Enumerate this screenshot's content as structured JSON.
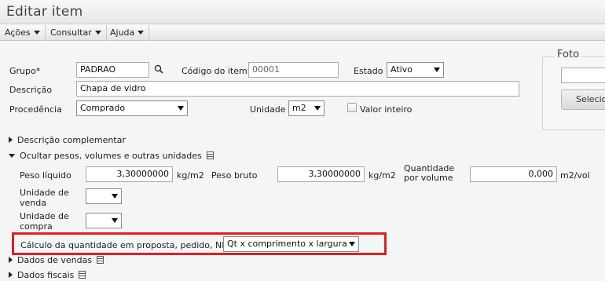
{
  "window": {
    "title": "Editar item"
  },
  "menus": [
    {
      "label": "Ações"
    },
    {
      "label": "Consultar"
    },
    {
      "label": "Ajuda"
    }
  ],
  "form": {
    "grupo": {
      "label": "Grupo*",
      "value": "PADRAO"
    },
    "codigo": {
      "label": "Código do item",
      "value": "00001"
    },
    "estado": {
      "label": "Estado",
      "value": "Ativo"
    },
    "descricao": {
      "label": "Descrição",
      "value": "Chapa de vidro"
    },
    "procedencia": {
      "label": "Procedência",
      "value": "Comprado"
    },
    "unidade": {
      "label": "Unidade",
      "value": "m2"
    },
    "valor_inteiro": {
      "label": "Valor inteiro",
      "checked": false
    }
  },
  "foto": {
    "legend": "Foto",
    "button_label": "Selecio"
  },
  "sections": {
    "descricao_complementar": "Descrição complementar",
    "ocultar_pesos": "Ocultar pesos, volumes e outras unidades",
    "dados_vendas": "Dados de vendas",
    "dados_fiscais": "Dados fiscais"
  },
  "weights": {
    "peso_liquido": {
      "label": "Peso líquido",
      "value": "3,30000000",
      "unit": "kg/m2"
    },
    "peso_bruto": {
      "label": "Peso bruto",
      "value": "3,30000000",
      "unit": "kg/m2"
    },
    "quantidade_volume": {
      "label_line1": "Quantidade",
      "label_line2": "por volume",
      "value": "0,000",
      "unit": "m2/vol"
    },
    "unidade_venda": {
      "label_line1": "Unidade de",
      "label_line2": "venda",
      "value": ""
    },
    "unidade_compra": {
      "label_line1": "Unidade de",
      "label_line2": "compra",
      "value": ""
    },
    "calculo": {
      "label": "Cálculo da quantidade em proposta, pedido, NF",
      "value": "Qt x comprimento x largura"
    }
  },
  "colors": {
    "highlight": "#e01e25"
  },
  "icons": [
    "search-icon",
    "dropdown-arrow-icon",
    "note-icon",
    "expand-arrow-icon",
    "collapse-arrow-icon"
  ]
}
